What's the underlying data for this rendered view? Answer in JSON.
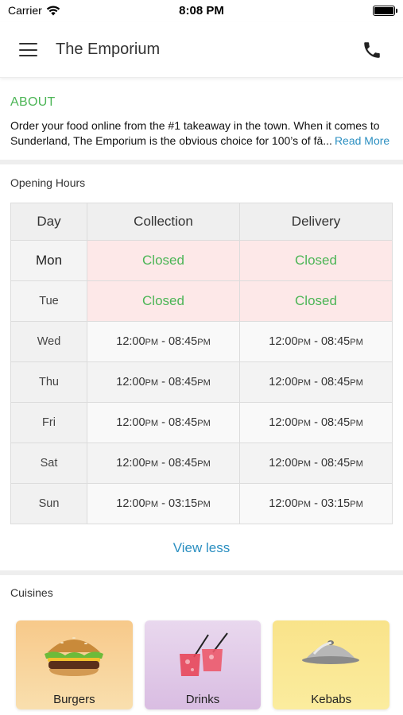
{
  "status_bar": {
    "carrier": "Carrier",
    "time": "8:08 PM"
  },
  "header": {
    "title": "The Emporium"
  },
  "about": {
    "heading": "ABOUT",
    "line1": "Order your food online from the #1 takeaway in the town. When it comes to",
    "line2": "Sunderland, The Emporium is the obvious choice for 100’s of fā...",
    "read_more": "Read More"
  },
  "opening_hours": {
    "label": "Opening Hours",
    "columns": [
      "Day",
      "Collection",
      "Delivery"
    ],
    "rows": [
      {
        "day": "Mon",
        "collection": "Closed",
        "delivery": "Closed"
      },
      {
        "day": "Tue",
        "collection": "Closed",
        "delivery": "Closed"
      },
      {
        "day": "Wed",
        "c_open": "12:00",
        "c_close": "08:45",
        "d_open": "12:00",
        "d_close": "08:45"
      },
      {
        "day": "Thu",
        "c_open": "12:00",
        "c_close": "08:45",
        "d_open": "12:00",
        "d_close": "08:45"
      },
      {
        "day": "Fri",
        "c_open": "12:00",
        "c_close": "08:45",
        "d_open": "12:00",
        "d_close": "08:45"
      },
      {
        "day": "Sat",
        "c_open": "12:00",
        "c_close": "08:45",
        "d_open": "12:00",
        "d_close": "08:45"
      },
      {
        "day": "Sun",
        "c_open": "12:00",
        "c_close": "03:15",
        "d_open": "12:00",
        "d_close": "03:15"
      }
    ],
    "meridiem": "PM",
    "separator": " - ",
    "view_less": "View less"
  },
  "cuisines": {
    "label": "Cuisines",
    "items": [
      {
        "name": "Burgers",
        "icon": "burger-icon"
      },
      {
        "name": "Drinks",
        "icon": "drinks-icon"
      },
      {
        "name": "Kebabs",
        "icon": "cloche-icon"
      }
    ]
  },
  "colors": {
    "accent_green": "#4cb556",
    "link_blue": "#2b8fc1",
    "closed_bg": "#fde8e8"
  }
}
